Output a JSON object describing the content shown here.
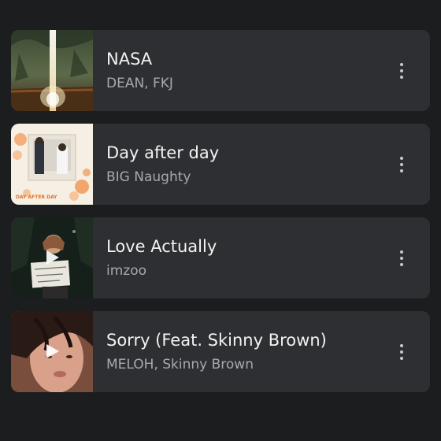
{
  "tracks": [
    {
      "title": "NASA",
      "artist": "DEAN, FKJ",
      "artwork": "nasa-cover",
      "show_play": false
    },
    {
      "title": "Day after day",
      "artist": "BIG Naughty",
      "artwork": "day-after-day-cover",
      "cover_caption": "DAY AFTER DAY",
      "show_play": false
    },
    {
      "title": "Love Actually",
      "artist": "imzoo",
      "artwork": "love-actually-cover",
      "show_play": true
    },
    {
      "title": "Sorry (Feat. Skinny Brown)",
      "artist": "MELOH, Skinny Brown",
      "artwork": "sorry-cover",
      "show_play": true
    }
  ],
  "icons": {
    "more": "more-vertical-icon",
    "play": "play-icon"
  },
  "colors": {
    "background": "#1c1d1f",
    "card": "#2e2f32",
    "title": "#f2f2f2",
    "subtitle": "#a8a9ab"
  }
}
